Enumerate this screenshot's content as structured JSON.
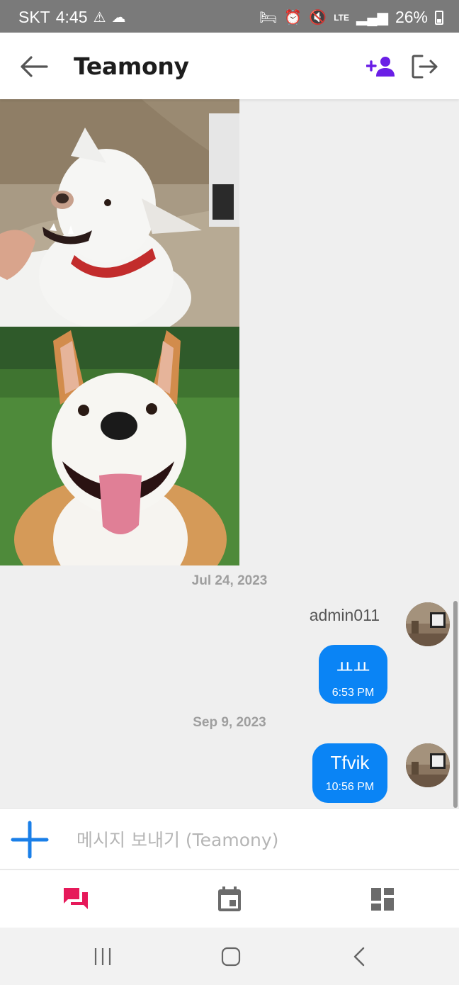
{
  "status_bar": {
    "carrier": "SKT",
    "time": "4:45",
    "network": "LTE",
    "battery": "26%"
  },
  "header": {
    "title": "Teamony"
  },
  "colors": {
    "accent_purple": "#6a1ee6",
    "bubble_blue": "#0a84f5",
    "nav_active": "#e6195a",
    "nav_inactive": "#6b6b6b"
  },
  "chat": {
    "groups": [
      {
        "date": "Jul 24, 2023",
        "sender": "admin011",
        "message": "ㅛㅛ",
        "time": "6:53 PM"
      },
      {
        "date": "Sep 9, 2023",
        "message": "Tfvik",
        "time": "10:56 PM"
      }
    ]
  },
  "composer": {
    "placeholder": "메시지 보내기 (Teamony)"
  },
  "bottom_nav": {
    "tabs": [
      {
        "icon": "chat-icon",
        "active": true
      },
      {
        "icon": "calendar-icon",
        "active": false
      },
      {
        "icon": "dashboard-icon",
        "active": false
      }
    ]
  }
}
